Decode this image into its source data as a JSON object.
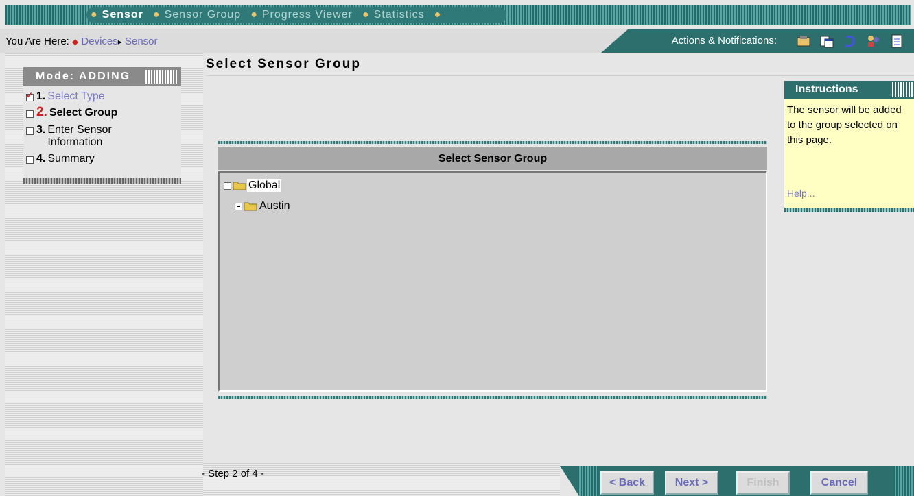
{
  "nav": {
    "tabs": [
      {
        "label": "Sensor",
        "active": true
      },
      {
        "label": "Sensor Group",
        "active": false
      },
      {
        "label": "Progress Viewer",
        "active": false
      },
      {
        "label": "Statistics",
        "active": false
      }
    ]
  },
  "breadcrumb": {
    "prefix": "You Are Here:",
    "items": [
      "Devices",
      "Sensor"
    ]
  },
  "actions": {
    "label": "Actions & Notifications:",
    "icons": [
      "tools-icon",
      "windows-icon",
      "refresh-icon",
      "people-icon",
      "document-icon"
    ]
  },
  "wizard": {
    "mode": "Mode: ADDING",
    "steps": [
      {
        "num": "1.",
        "label": "Select Type",
        "state": "done"
      },
      {
        "num": "2.",
        "label": "Select Group",
        "state": "current"
      },
      {
        "num": "3.",
        "label": "Enter Sensor",
        "label2": "Information",
        "state": "todo"
      },
      {
        "num": "4.",
        "label": "Summary",
        "state": "todo"
      }
    ]
  },
  "page": {
    "title": "Select Sensor Group"
  },
  "panel": {
    "header": "Select Sensor Group",
    "tree": [
      {
        "label": "Global",
        "level": 0
      },
      {
        "label": "Austin",
        "level": 1
      }
    ]
  },
  "instructions": {
    "title": "Instructions",
    "text": "The sensor will be added to the group selected on this page.",
    "help": "Help..."
  },
  "footer": {
    "step": "- Step 2 of 4 -",
    "back": "< Back",
    "next": "Next >",
    "finish": "Finish",
    "cancel": "Cancel"
  },
  "colors": {
    "teal": "#2c6f6d",
    "link": "#6a6ab8",
    "accent_red": "#cc2222",
    "instructions_bg": "#ffffc4"
  }
}
